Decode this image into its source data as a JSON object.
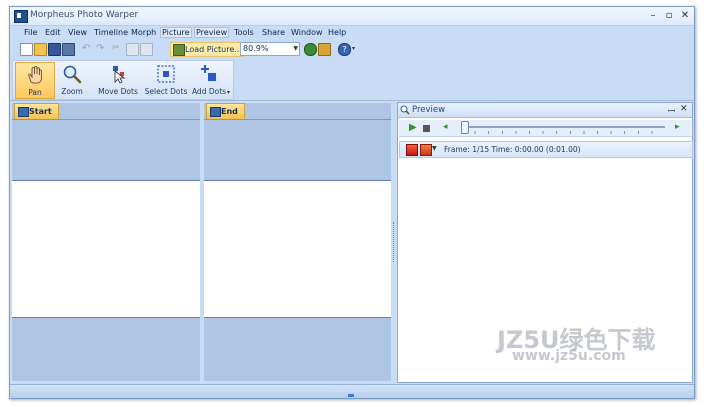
{
  "window": {
    "title": "Morpheus Photo Warper"
  },
  "menu": [
    "File",
    "Edit",
    "View",
    "Timeline",
    "Morph",
    "Picture",
    "Preview",
    "Tools",
    "Share",
    "Window",
    "Help"
  ],
  "toolbar": {
    "load_label": "Load Picture...",
    "zoom_value": "80.9%"
  },
  "ribbon": [
    {
      "label": "Pan",
      "icon": "hand-icon"
    },
    {
      "label": "Zoom",
      "icon": "magnifier-icon"
    },
    {
      "label": "Move Dots",
      "icon": "move-dots-icon"
    },
    {
      "label": "Select Dots",
      "icon": "select-dots-icon"
    },
    {
      "label": "Add Dots",
      "icon": "add-dots-icon"
    }
  ],
  "panels": {
    "start_tab": "Start",
    "end_tab": "End"
  },
  "preview": {
    "title": "Preview",
    "frame_info": "Frame: 1/15 Time: 0:00.00 (0:01.00)"
  },
  "watermark": {
    "line1": "JZ5U绿色下载",
    "line2": "www.jz5u.com"
  }
}
